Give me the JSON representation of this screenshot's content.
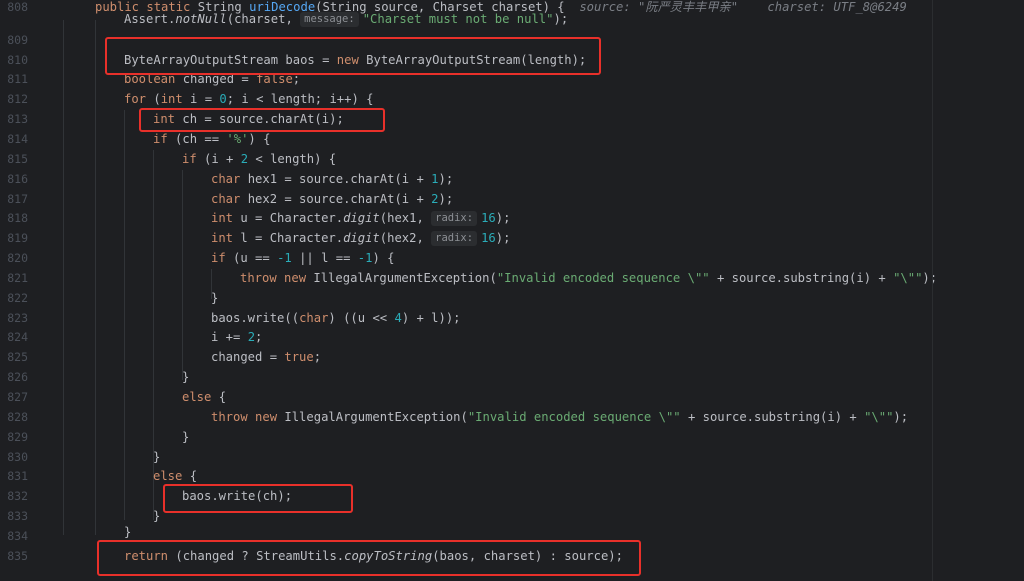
{
  "line_numbers": [
    "808",
    "809",
    "810",
    "811",
    "812",
    "813",
    "814",
    "815",
    "816",
    "817",
    "818",
    "819",
    "820",
    "821",
    "822",
    "823",
    "824",
    "825",
    "826",
    "827",
    "828",
    "829",
    "830",
    "831",
    "832",
    "833",
    "834",
    "835"
  ],
  "header": {
    "kw1": "public",
    "kw2": "static",
    "type": "String",
    "method": "uriDecode",
    "params": "(String source, Charset charset) {",
    "hint1": "source: \"阮严灵丰丰甲亲\"",
    "hint2": "charset: UTF_8@6249"
  },
  "assert": {
    "pre": "Assert.",
    "call": "notNull",
    "args": "(charset, ",
    "hint": "message:",
    "str": "\"Charset must not be null\"",
    "post": ");"
  },
  "l810": {
    "a": "ByteArrayOutputStream baos = ",
    "kw": "new",
    "b": " ByteArrayOutputStream(length);"
  },
  "l811": {
    "kw": "boolean",
    "a": " changed = ",
    "kw2": "false",
    "b": ";"
  },
  "l812": {
    "kw": "for",
    "a": " (",
    "kw2": "int",
    "b": " i = ",
    "n": "0",
    "c": "; i < length; i++) {"
  },
  "l813": {
    "kw": "int",
    "a": " ch = source.charAt(i);"
  },
  "l814": {
    "kw": "if",
    "a": " (ch == ",
    "s": "'%'",
    "b": ") {"
  },
  "l815": {
    "kw": "if",
    "a": " (i + ",
    "n": "2",
    "b": " < length) {"
  },
  "l816": {
    "kw": "char",
    "a": " hex1 = source.charAt(i + ",
    "n": "1",
    "b": ");"
  },
  "l817": {
    "kw": "char",
    "a": " hex2 = source.charAt(i + ",
    "n": "2",
    "b": ");"
  },
  "l818": {
    "kw": "int",
    "a": " u = Character.",
    "f": "digit",
    "b": "(hex1, ",
    "hint": "radix:",
    "n": "16",
    "c": ");"
  },
  "l819": {
    "kw": "int",
    "a": " l = Character.",
    "f": "digit",
    "b": "(hex2, ",
    "hint": "radix:",
    "n": "16",
    "c": ");"
  },
  "l820": {
    "kw": "if",
    "a": " (u == ",
    "n1": "-1",
    "b": " || l == ",
    "n2": "-1",
    "c": ") {"
  },
  "l821": {
    "kw": "throw",
    "kw2": "new",
    "a": " IllegalArgumentException(",
    "s1": "\"Invalid encoded sequence \\\"\"",
    "b": " + source.substring(i) + ",
    "s2": "\"\\\"\"",
    "c": ");"
  },
  "l822": "}",
  "l823": {
    "a": "baos.write((",
    "kw": "char",
    "b": ") ((u << ",
    "n": "4",
    "c": ") + l));"
  },
  "l824": {
    "a": "i += ",
    "n": "2",
    "b": ";"
  },
  "l825": {
    "a": "changed = ",
    "kw": "true",
    "b": ";"
  },
  "l826": "}",
  "l827": {
    "kw": "else",
    "a": " {"
  },
  "l828": {
    "kw": "throw",
    "kw2": "new",
    "a": " IllegalArgumentException(",
    "s1": "\"Invalid encoded sequence \\\"\"",
    "b": " + source.substring(i) + ",
    "s2": "\"\\\"\"",
    "c": ");"
  },
  "l829": "}",
  "l830": "}",
  "l831": {
    "kw": "else",
    "a": " {"
  },
  "l832": "baos.write(ch);",
  "l833": "}",
  "l834": "}",
  "l835": {
    "kw": "return",
    "a": " (changed ? StreamUtils.",
    "f": "copyToString",
    "b": "(baos, charset) : source);"
  },
  "colors": {
    "keyword": "#cf8e6d",
    "method": "#56a8f5",
    "number": "#2aacb8",
    "string": "#6aab73",
    "text": "#bcbec4",
    "highlight_box": "#e8302a"
  }
}
